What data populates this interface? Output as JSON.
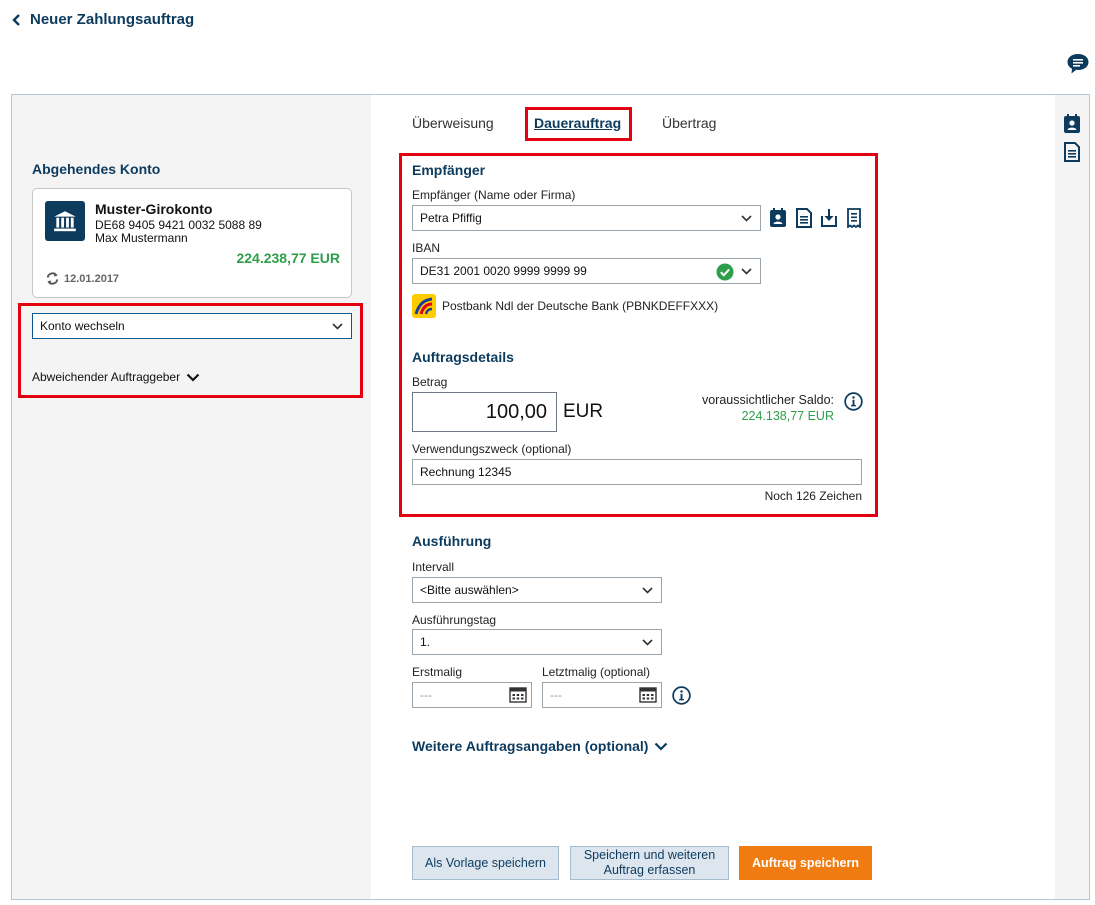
{
  "header": {
    "back_label": "Neuer Zahlungsauftrag"
  },
  "left": {
    "title": "Abgehendes Konto",
    "account": {
      "name": "Muster-Girokonto",
      "iban": "DE68 9405 9421 0032 5088 89",
      "holder": "Max Mustermann",
      "balance": "224.238,77 EUR",
      "updated": "12.01.2017"
    },
    "switch_select": "Konto wechseln",
    "other_originator": "Abweichender Auftraggeber"
  },
  "tabs": [
    {
      "label": "Überweisung",
      "active": false
    },
    {
      "label": "Dauerauftrag",
      "active": true
    },
    {
      "label": "Übertrag",
      "active": false
    }
  ],
  "recipient": {
    "title": "Empfänger",
    "name_label": "Empfänger (Name oder Firma)",
    "name_value": "Petra Pfiffig",
    "iban_label": "IBAN",
    "iban_value": "DE31 2001 0020 9999 9999 99",
    "bank_name": "Postbank Ndl der Deutsche Bank  (PBNKDEFFXXX)"
  },
  "details": {
    "title": "Auftragsdetails",
    "amount_label": "Betrag",
    "amount_value": "100,00",
    "currency": "EUR",
    "saldo_label": "voraussichtlicher Saldo:",
    "saldo_value": "224.138,77 EUR",
    "purpose_label": "Verwendungszweck (optional)",
    "purpose_value": "Rechnung 12345",
    "remaining": "Noch 126 Zeichen"
  },
  "execution": {
    "title": "Ausführung",
    "interval_label": "Intervall",
    "interval_value": "<Bitte auswählen>",
    "day_label": "Ausführungstag",
    "day_value": "1.",
    "first_label": "Erstmalig",
    "first_placeholder": "---",
    "last_label": "Letztmalig (optional)",
    "last_placeholder": "---"
  },
  "more_details": "Weitere Auftragsangaben (optional)",
  "buttons": {
    "template": "Als Vorlage speichern",
    "save_more": "Speichern und weiteren Auftrag erfassen",
    "save": "Auftrag speichern"
  },
  "colors": {
    "navy": "#0d3b5e",
    "accent_orange": "#f07b10",
    "positive_green": "#2e9e4a",
    "highlight_red": "#e3000f"
  }
}
